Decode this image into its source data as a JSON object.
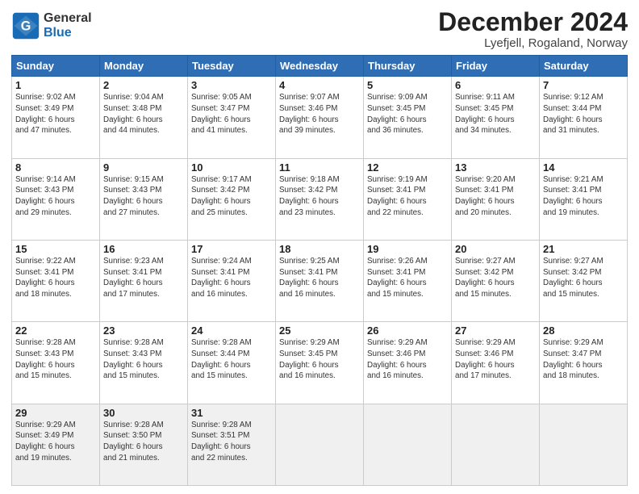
{
  "header": {
    "logo_general": "General",
    "logo_blue": "Blue",
    "title": "December 2024",
    "subtitle": "Lyefjell, Rogaland, Norway"
  },
  "days_of_week": [
    "Sunday",
    "Monday",
    "Tuesday",
    "Wednesday",
    "Thursday",
    "Friday",
    "Saturday"
  ],
  "weeks": [
    [
      {
        "day": "1",
        "lines": [
          "Sunrise: 9:02 AM",
          "Sunset: 3:49 PM",
          "Daylight: 6 hours",
          "and 47 minutes."
        ]
      },
      {
        "day": "2",
        "lines": [
          "Sunrise: 9:04 AM",
          "Sunset: 3:48 PM",
          "Daylight: 6 hours",
          "and 44 minutes."
        ]
      },
      {
        "day": "3",
        "lines": [
          "Sunrise: 9:05 AM",
          "Sunset: 3:47 PM",
          "Daylight: 6 hours",
          "and 41 minutes."
        ]
      },
      {
        "day": "4",
        "lines": [
          "Sunrise: 9:07 AM",
          "Sunset: 3:46 PM",
          "Daylight: 6 hours",
          "and 39 minutes."
        ]
      },
      {
        "day": "5",
        "lines": [
          "Sunrise: 9:09 AM",
          "Sunset: 3:45 PM",
          "Daylight: 6 hours",
          "and 36 minutes."
        ]
      },
      {
        "day": "6",
        "lines": [
          "Sunrise: 9:11 AM",
          "Sunset: 3:45 PM",
          "Daylight: 6 hours",
          "and 34 minutes."
        ]
      },
      {
        "day": "7",
        "lines": [
          "Sunrise: 9:12 AM",
          "Sunset: 3:44 PM",
          "Daylight: 6 hours",
          "and 31 minutes."
        ]
      }
    ],
    [
      {
        "day": "8",
        "lines": [
          "Sunrise: 9:14 AM",
          "Sunset: 3:43 PM",
          "Daylight: 6 hours",
          "and 29 minutes."
        ]
      },
      {
        "day": "9",
        "lines": [
          "Sunrise: 9:15 AM",
          "Sunset: 3:43 PM",
          "Daylight: 6 hours",
          "and 27 minutes."
        ]
      },
      {
        "day": "10",
        "lines": [
          "Sunrise: 9:17 AM",
          "Sunset: 3:42 PM",
          "Daylight: 6 hours",
          "and 25 minutes."
        ]
      },
      {
        "day": "11",
        "lines": [
          "Sunrise: 9:18 AM",
          "Sunset: 3:42 PM",
          "Daylight: 6 hours",
          "and 23 minutes."
        ]
      },
      {
        "day": "12",
        "lines": [
          "Sunrise: 9:19 AM",
          "Sunset: 3:41 PM",
          "Daylight: 6 hours",
          "and 22 minutes."
        ]
      },
      {
        "day": "13",
        "lines": [
          "Sunrise: 9:20 AM",
          "Sunset: 3:41 PM",
          "Daylight: 6 hours",
          "and 20 minutes."
        ]
      },
      {
        "day": "14",
        "lines": [
          "Sunrise: 9:21 AM",
          "Sunset: 3:41 PM",
          "Daylight: 6 hours",
          "and 19 minutes."
        ]
      }
    ],
    [
      {
        "day": "15",
        "lines": [
          "Sunrise: 9:22 AM",
          "Sunset: 3:41 PM",
          "Daylight: 6 hours",
          "and 18 minutes."
        ]
      },
      {
        "day": "16",
        "lines": [
          "Sunrise: 9:23 AM",
          "Sunset: 3:41 PM",
          "Daylight: 6 hours",
          "and 17 minutes."
        ]
      },
      {
        "day": "17",
        "lines": [
          "Sunrise: 9:24 AM",
          "Sunset: 3:41 PM",
          "Daylight: 6 hours",
          "and 16 minutes."
        ]
      },
      {
        "day": "18",
        "lines": [
          "Sunrise: 9:25 AM",
          "Sunset: 3:41 PM",
          "Daylight: 6 hours",
          "and 16 minutes."
        ]
      },
      {
        "day": "19",
        "lines": [
          "Sunrise: 9:26 AM",
          "Sunset: 3:41 PM",
          "Daylight: 6 hours",
          "and 15 minutes."
        ]
      },
      {
        "day": "20",
        "lines": [
          "Sunrise: 9:27 AM",
          "Sunset: 3:42 PM",
          "Daylight: 6 hours",
          "and 15 minutes."
        ]
      },
      {
        "day": "21",
        "lines": [
          "Sunrise: 9:27 AM",
          "Sunset: 3:42 PM",
          "Daylight: 6 hours",
          "and 15 minutes."
        ]
      }
    ],
    [
      {
        "day": "22",
        "lines": [
          "Sunrise: 9:28 AM",
          "Sunset: 3:43 PM",
          "Daylight: 6 hours",
          "and 15 minutes."
        ]
      },
      {
        "day": "23",
        "lines": [
          "Sunrise: 9:28 AM",
          "Sunset: 3:43 PM",
          "Daylight: 6 hours",
          "and 15 minutes."
        ]
      },
      {
        "day": "24",
        "lines": [
          "Sunrise: 9:28 AM",
          "Sunset: 3:44 PM",
          "Daylight: 6 hours",
          "and 15 minutes."
        ]
      },
      {
        "day": "25",
        "lines": [
          "Sunrise: 9:29 AM",
          "Sunset: 3:45 PM",
          "Daylight: 6 hours",
          "and 16 minutes."
        ]
      },
      {
        "day": "26",
        "lines": [
          "Sunrise: 9:29 AM",
          "Sunset: 3:46 PM",
          "Daylight: 6 hours",
          "and 16 minutes."
        ]
      },
      {
        "day": "27",
        "lines": [
          "Sunrise: 9:29 AM",
          "Sunset: 3:46 PM",
          "Daylight: 6 hours",
          "and 17 minutes."
        ]
      },
      {
        "day": "28",
        "lines": [
          "Sunrise: 9:29 AM",
          "Sunset: 3:47 PM",
          "Daylight: 6 hours",
          "and 18 minutes."
        ]
      }
    ],
    [
      {
        "day": "29",
        "lines": [
          "Sunrise: 9:29 AM",
          "Sunset: 3:49 PM",
          "Daylight: 6 hours",
          "and 19 minutes."
        ]
      },
      {
        "day": "30",
        "lines": [
          "Sunrise: 9:28 AM",
          "Sunset: 3:50 PM",
          "Daylight: 6 hours",
          "and 21 minutes."
        ]
      },
      {
        "day": "31",
        "lines": [
          "Sunrise: 9:28 AM",
          "Sunset: 3:51 PM",
          "Daylight: 6 hours",
          "and 22 minutes."
        ]
      },
      {
        "day": "",
        "lines": []
      },
      {
        "day": "",
        "lines": []
      },
      {
        "day": "",
        "lines": []
      },
      {
        "day": "",
        "lines": []
      }
    ]
  ]
}
